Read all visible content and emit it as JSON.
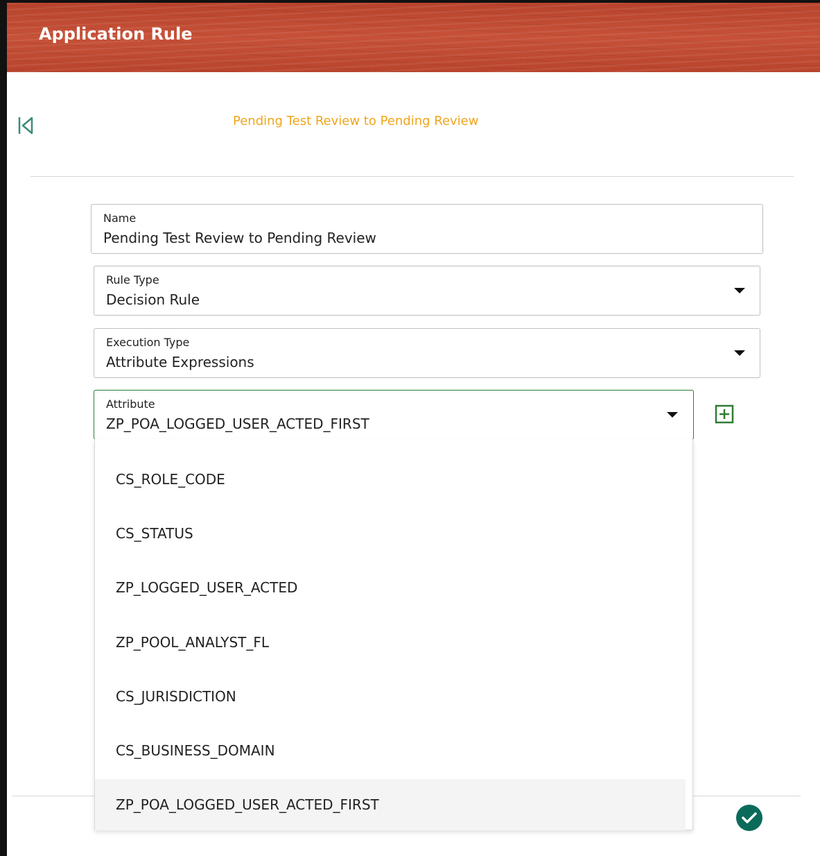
{
  "header": {
    "title": "Application Rule"
  },
  "page": {
    "subtitle": "Pending Test Review to Pending Review"
  },
  "form": {
    "name": {
      "label": "Name",
      "value": "Pending Test Review to Pending Review"
    },
    "rule_type": {
      "label": "Rule Type",
      "value": "Decision Rule"
    },
    "execution_type": {
      "label": "Execution Type",
      "value": "Attribute Expressions"
    },
    "attribute": {
      "label": "Attribute",
      "value": "ZP_POA_LOGGED_USER_ACTED_FIRST",
      "options": [
        "CS_ROLE_CODE",
        "CS_STATUS",
        "ZP_LOGGED_USER_ACTED",
        "ZP_POOL_ANALYST_FL",
        "CS_JURISDICTION",
        "CS_BUSINESS_DOMAIN",
        "ZP_POA_LOGGED_USER_ACTED_FIRST"
      ],
      "selected_index": 6
    }
  },
  "icons": {
    "back": "first-page-icon",
    "add": "add-box-icon",
    "submit": "check-circle-icon",
    "dropdown": "caret-down-icon"
  },
  "colors": {
    "header_bg": "#c14a32",
    "subtitle": "#f0a51c",
    "accent_green": "#2e7d32",
    "submit_teal": "#0b6b5a"
  }
}
